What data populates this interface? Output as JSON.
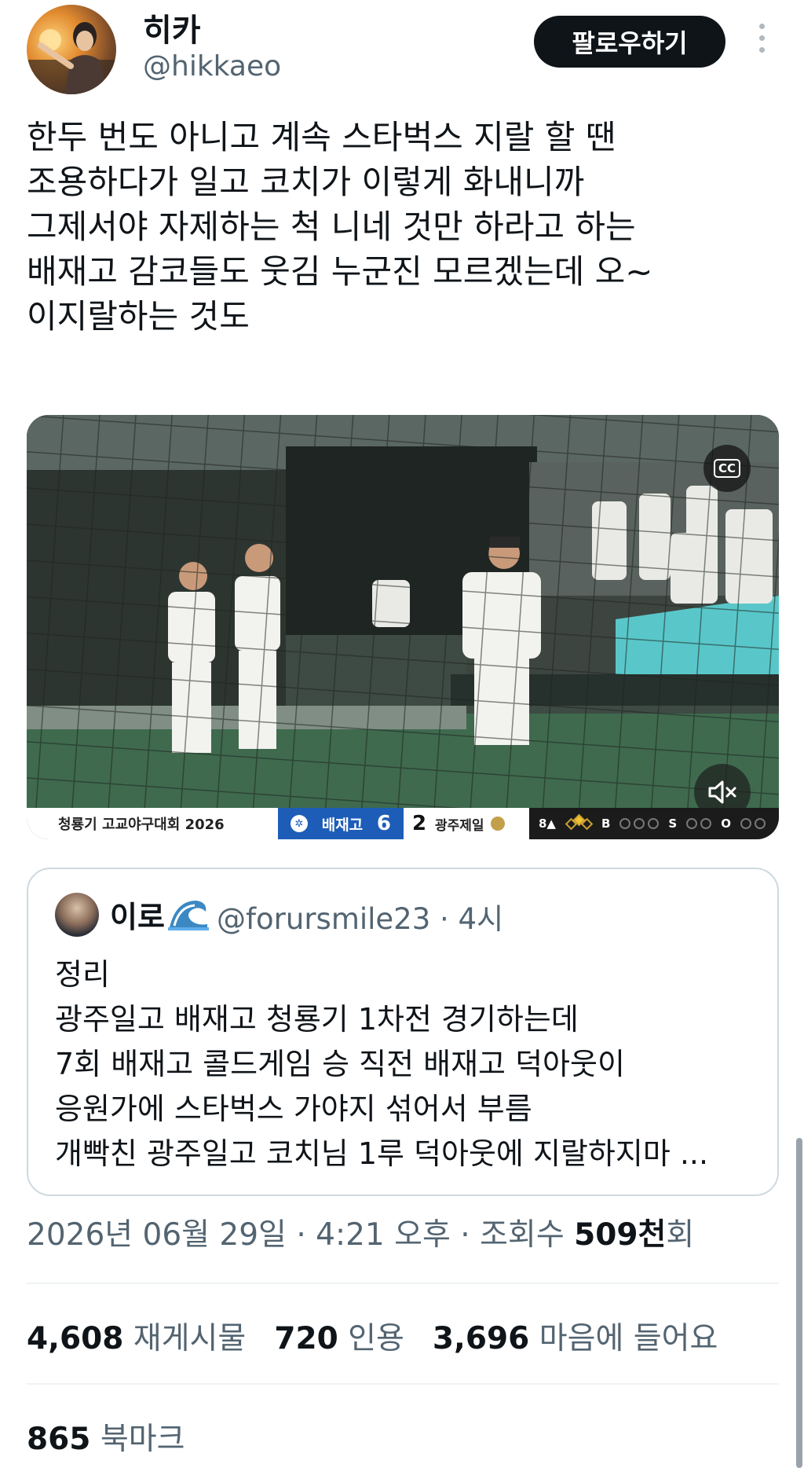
{
  "header": {
    "display_name": "히카",
    "handle": "@hikkaeo",
    "follow_label": "팔로우하기"
  },
  "tweet": {
    "text": "한두 번도 아니고 계속 스타벅스 지랄 할 땐\n조용하다가 일고 코치가 이렇게 화내니까\n그제서야 자제하는 척 니네 것만 하라고 하는\n배재고 감코들도 웃김 누군진 모르겠는데 오~\n이지랄하는 것도"
  },
  "media": {
    "cc_label": "CC",
    "scoreboard": {
      "tournament": "청룡기 고교야구대회 2026",
      "team1": "배재고",
      "score1": "6",
      "score2": "2",
      "team2": "광주제일",
      "inning": "8▲",
      "balls_label": "B",
      "strikes_label": "S",
      "outs_label": "O"
    }
  },
  "quote": {
    "name": "이로",
    "handle_time": "@forursmile23 · 4시",
    "text": "정리\n광주일고 배재고 청룡기 1차전 경기하는데\n7회 배재고 콜드게임 승 직전 배재고 덕아웃이\n응원가에 스타벅스 가야지 섞어서 부름\n개빡친 광주일고 코치님 1루 덕아웃에 지랄하지마 ..."
  },
  "meta": {
    "date_time": "2026년 06월 29일 · 4:21 오후 · 조회수 ",
    "views_number": "509천",
    "views_suffix": "회"
  },
  "stats": {
    "retweets": "4,608",
    "retweets_label": "재게시물",
    "quotes": "720",
    "quotes_label": "인용",
    "likes": "3,696",
    "likes_label": "마음에 들어요"
  },
  "bookmarks": {
    "count": "865",
    "label": "북마크"
  }
}
